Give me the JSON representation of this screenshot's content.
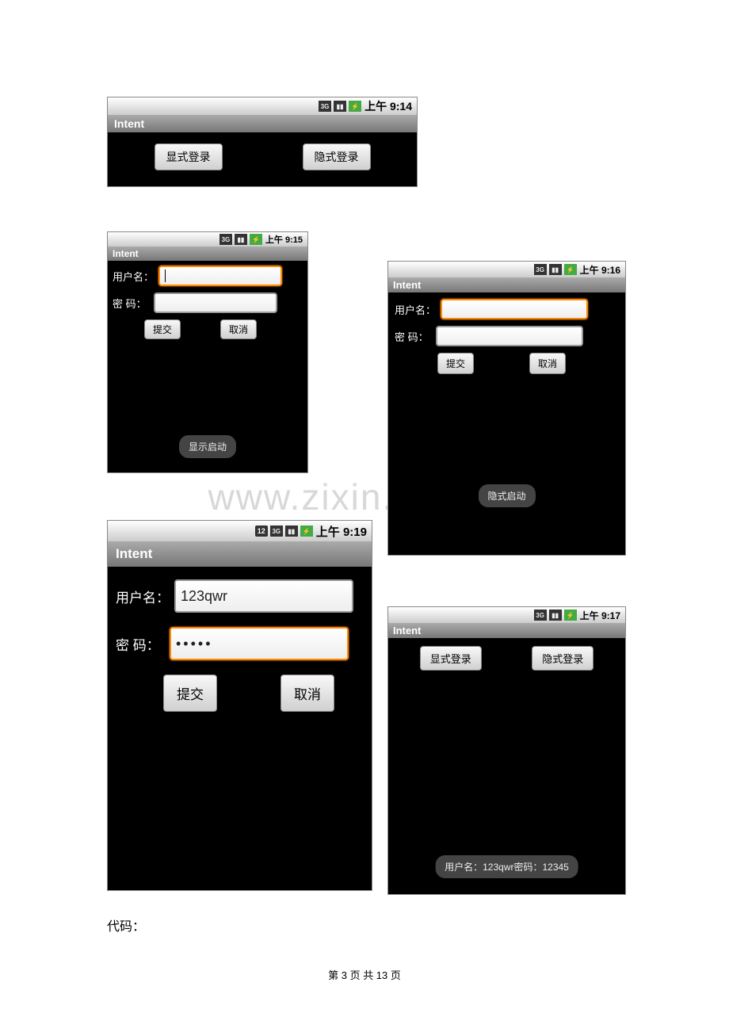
{
  "watermark": "www.zixin.com.cn",
  "body_text": "代码：",
  "footer": "第 3 页 共 13 页",
  "phones": {
    "p1": {
      "title": "Intent",
      "time": "上午 9:14",
      "buttons": {
        "explicit": "显式登录",
        "implicit": "隐式登录"
      }
    },
    "p2": {
      "title": "Intent",
      "time": "上午 9:15",
      "labels": {
        "username": "用户名：",
        "password": "密 码："
      },
      "buttons": {
        "submit": "提交",
        "cancel": "取消"
      },
      "toast": "显示启动"
    },
    "p3": {
      "title": "Intent",
      "time": "上午 9:16",
      "labels": {
        "username": "用户名：",
        "password": "密 码："
      },
      "buttons": {
        "submit": "提交",
        "cancel": "取消"
      },
      "toast": "隐式启动"
    },
    "p4": {
      "title": "Intent",
      "notif_count": "12",
      "time": "上午 9:19",
      "labels": {
        "username": "用户名：",
        "password": "密 码："
      },
      "values": {
        "username": "123qwr",
        "password": "•••••"
      },
      "buttons": {
        "submit": "提交",
        "cancel": "取消"
      }
    },
    "p5": {
      "title": "Intent",
      "time": "上午 9:17",
      "buttons": {
        "explicit": "显式登录",
        "implicit": "隐式登录"
      },
      "toast": "用户名：123qwr密码：12345"
    }
  },
  "icons": {
    "threeg": "3G",
    "signal": "▮",
    "battery": "⚡"
  }
}
